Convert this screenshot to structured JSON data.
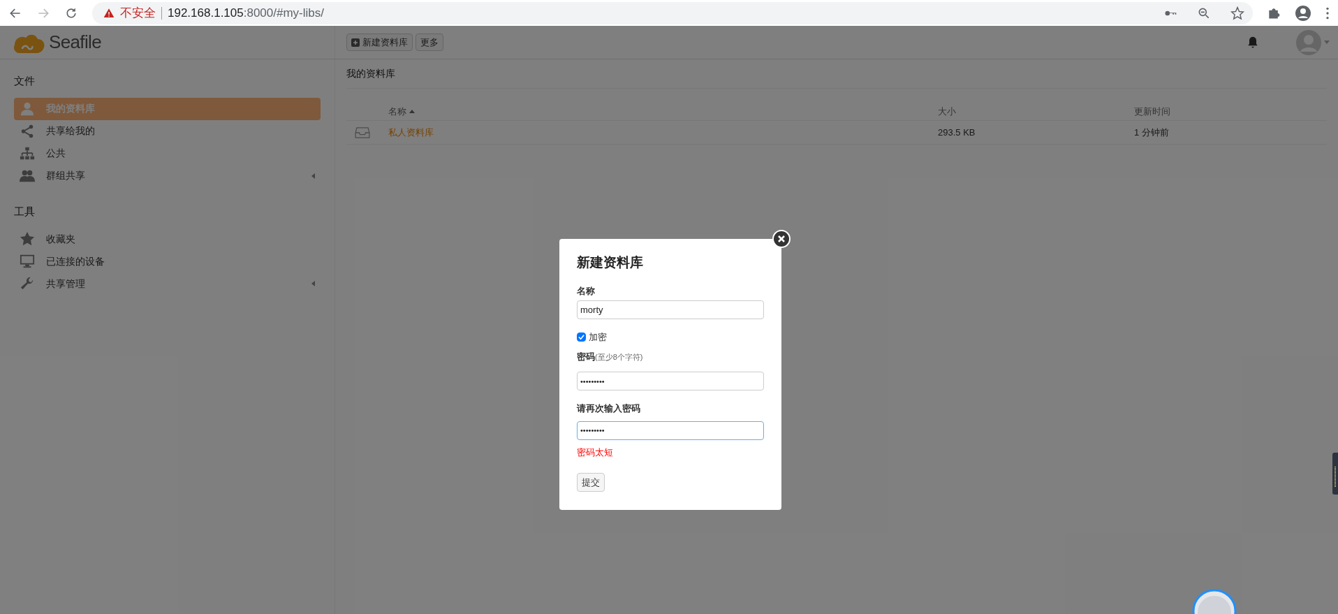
{
  "browser": {
    "security_label": "不安全",
    "url_host": "192.168.1.105",
    "url_rest": ":8000/#my-libs/"
  },
  "app": {
    "logo_text": "Seafile"
  },
  "toolbar": {
    "buttons": [
      {
        "label": "新建资料库",
        "kind": "add"
      },
      {
        "label": "更多",
        "kind": "plain"
      }
    ]
  },
  "sidebar": {
    "sections": [
      {
        "heading": "文件",
        "items": [
          {
            "label": "我的资料库",
            "selected": true,
            "expandable": false
          },
          {
            "label": "共享给我的",
            "selected": false,
            "expandable": false
          },
          {
            "label": "公共",
            "selected": false,
            "expandable": false
          },
          {
            "label": "群组共享",
            "selected": false,
            "expandable": true
          }
        ]
      },
      {
        "heading": "工具",
        "items": [
          {
            "label": "收藏夹",
            "selected": false,
            "expandable": false
          },
          {
            "label": "已连接的设备",
            "selected": false,
            "expandable": false
          },
          {
            "label": "共享管理",
            "selected": false,
            "expandable": true
          }
        ]
      }
    ]
  },
  "main": {
    "title": "我的资料库",
    "table": {
      "columns": [
        {
          "label": "名称",
          "sorted": true
        },
        {
          "label": "大小",
          "sorted": false
        },
        {
          "label": "更新时间",
          "sorted": false
        }
      ],
      "rows": [
        {
          "name": "私人资料库",
          "size": "293.5 KB",
          "updated": "1 分钟前"
        }
      ]
    }
  },
  "dialog": {
    "title": "新建资料库",
    "name_label": "名称",
    "name_value": "morty",
    "encrypt_label": "加密",
    "encrypt_checked": true,
    "password_label": "密码",
    "password_hint": "(至少8个字符)",
    "password_value": "•••••••••",
    "confirm_label": "请再次输入密码",
    "confirm_value": "•••••••••",
    "confirm_focused": true,
    "error": "密码太短",
    "submit": "提交"
  }
}
